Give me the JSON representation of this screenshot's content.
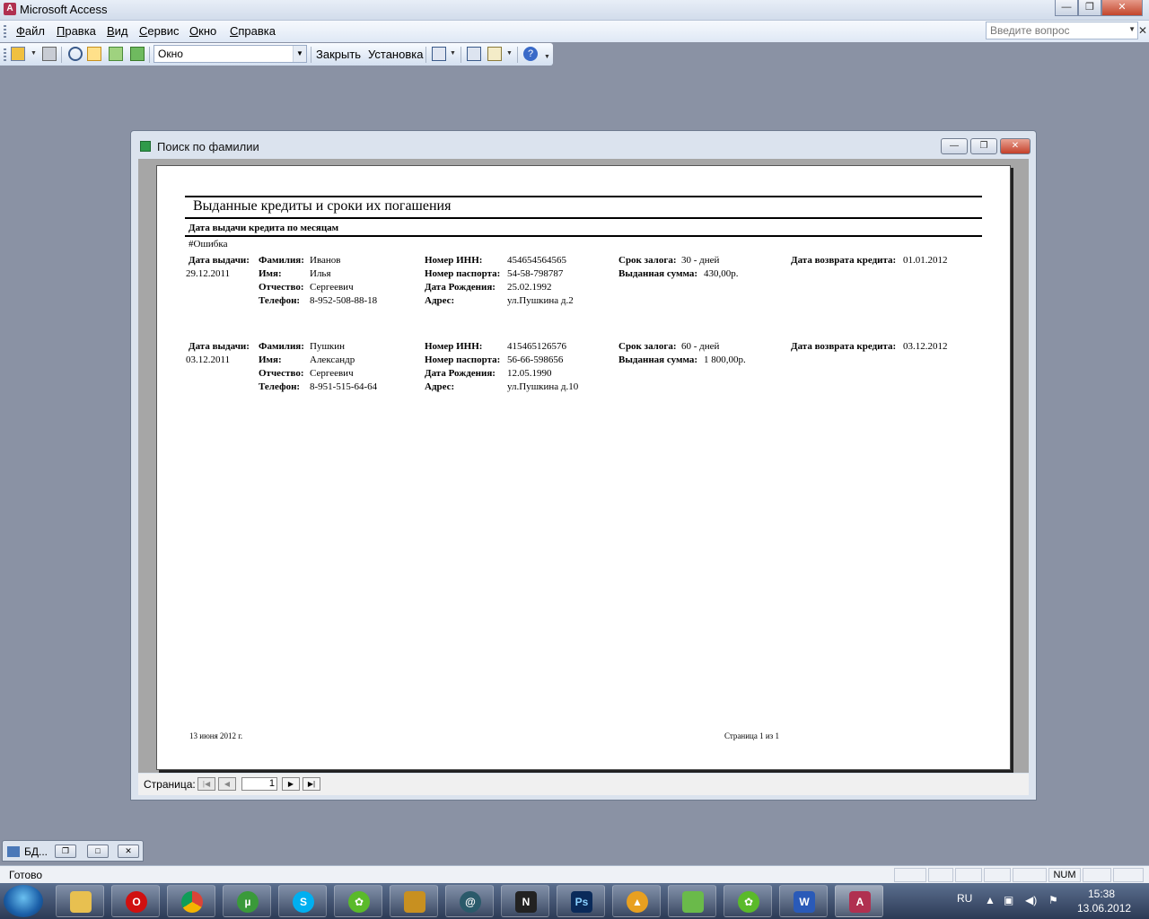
{
  "app": {
    "title": "Microsoft Access"
  },
  "menu": {
    "items": [
      "Файл",
      "Правка",
      "Вид",
      "Сервис",
      "Окно",
      "Справка"
    ],
    "help_placeholder": "Введите вопрос"
  },
  "toolbar": {
    "zoom_value": "Окно",
    "close_label": "Закрыть",
    "setup_label": "Установка"
  },
  "window": {
    "title": "Поиск по фамилии"
  },
  "report": {
    "title": "Выданные кредиты и сроки их погашения",
    "subtitle": "Дата выдачи кредита по месяцам",
    "error": "#Ошибка",
    "labels": {
      "issue_date": "Дата выдачи:",
      "last_name": "Фамилия:",
      "first_name": "Имя:",
      "patronymic": "Отчество:",
      "phone": "Телефон:",
      "inn": "Номер ИНН:",
      "passport": "Номер паспорта:",
      "birth": "Дата Рождения:",
      "address": "Адрес:",
      "term": "Срок залога:",
      "amount": "Выданная сумма:",
      "return": "Дата возврата кредита:"
    },
    "records": [
      {
        "issue_date": "29.12.2011",
        "last_name": "Иванов",
        "first_name": "Илья",
        "patronymic": "Сергеевич",
        "phone": "8-952-508-88-18",
        "inn": "454654564565",
        "passport": "54-58-798787",
        "birth": "25.02.1992",
        "address": "ул.Пушкина д.2",
        "term": "30 - дней",
        "amount": "430,00р.",
        "return": "01.01.2012"
      },
      {
        "issue_date": "03.12.2011",
        "last_name": "Пушкин",
        "first_name": "Александр",
        "patronymic": "Сергеевич",
        "phone": "8-951-515-64-64",
        "inn": "415465126576",
        "passport": "56-66-598656",
        "birth": "12.05.1990",
        "address": "ул.Пушкина д.10",
        "term": "60 - дней",
        "amount": "1 800,00р.",
        "return": "03.12.2012"
      }
    ],
    "footer_date": "13 июня 2012 г.",
    "footer_page": "Страница 1 из 1"
  },
  "nav": {
    "label": "Страница:",
    "page": "1"
  },
  "mini_window": {
    "title": "БД..."
  },
  "status": {
    "text": "Готово",
    "num": "NUM"
  },
  "tray": {
    "lang": "RU",
    "time": "15:38",
    "date": "13.06.2012"
  }
}
